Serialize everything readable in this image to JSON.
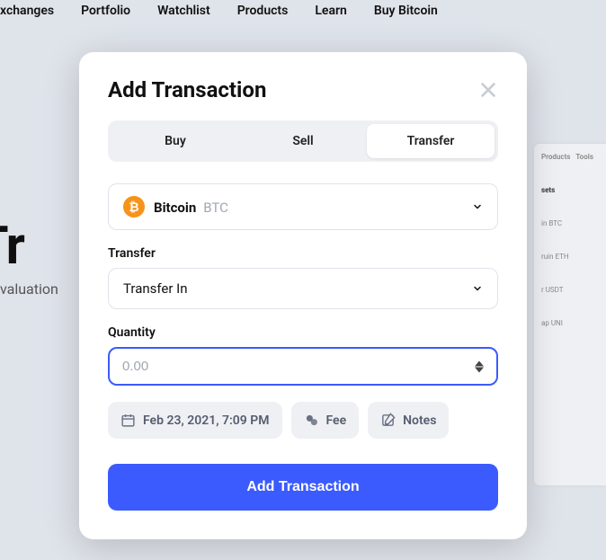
{
  "nav": {
    "items": [
      "xchanges",
      "Portfolio",
      "Watchlist",
      "Products",
      "Learn",
      "Buy Bitcoin"
    ]
  },
  "background": {
    "heading": "o Tr",
    "sub": "valuation"
  },
  "rightPanel": {
    "tabs": [
      "Products",
      "Tools"
    ],
    "assetsHeading": "sets",
    "rows": [
      "in BTC",
      "ruin ETH",
      "r USDT",
      "ap UNI"
    ]
  },
  "modal": {
    "title": "Add Transaction",
    "tabs": {
      "buy": "Buy",
      "sell": "Sell",
      "transfer": "Transfer"
    },
    "coin": {
      "name": "Bitcoin",
      "symbol": "BTC"
    },
    "transferLabel": "Transfer",
    "transferValue": "Transfer In",
    "quantityLabel": "Quantity",
    "quantityPlaceholder": "0.00",
    "date": "Feb 23, 2021, 7:09 PM",
    "fee": "Fee",
    "notes": "Notes",
    "submit": "Add Transaction"
  }
}
